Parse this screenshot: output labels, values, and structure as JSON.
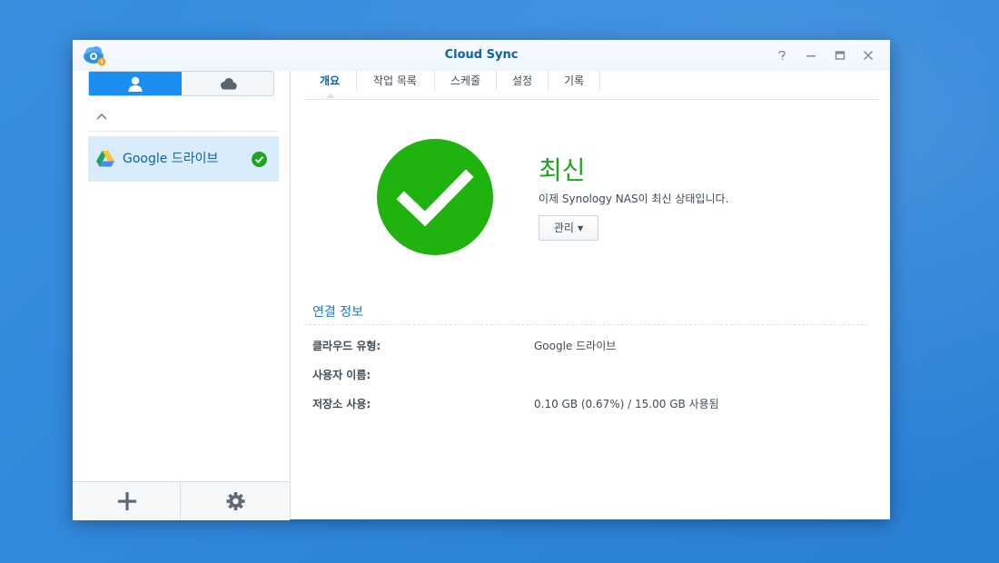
{
  "window": {
    "title": "Cloud Sync",
    "controls": [
      "help-icon",
      "minimize-icon",
      "maximize-icon",
      "close-icon"
    ]
  },
  "sidebar": {
    "segments": [
      {
        "icon": "user-icon",
        "active": true
      },
      {
        "icon": "cloud-icon",
        "active": false
      }
    ],
    "connections": [
      {
        "label": "Google 드라이브",
        "icon": "google-drive-icon",
        "status_icon": "check-circle-icon"
      }
    ],
    "footer": {
      "add_icon": "plus-icon",
      "settings_icon": "gear-icon"
    }
  },
  "tabs": [
    {
      "label": "개요",
      "active": true
    },
    {
      "label": "작업 목록",
      "active": false
    },
    {
      "label": "스케줄",
      "active": false
    },
    {
      "label": "설정",
      "active": false
    },
    {
      "label": "기록",
      "active": false
    }
  ],
  "status": {
    "title": "최신",
    "description": "이제 Synology NAS이 최신 상태입니다.",
    "manage_label": "관리",
    "color": "#20a521"
  },
  "connection_info": {
    "title": "연결 정보",
    "rows": [
      {
        "label": "클라우드 유형:",
        "value": "Google 드라이브"
      },
      {
        "label": "사용자 이름:",
        "value": ""
      },
      {
        "label": "저장소 사용:",
        "value": "0.10 GB (0.67%) / 15.00 GB 사용됨"
      }
    ]
  },
  "colors": {
    "accent": "#1b8ff1",
    "title_blue": "#0e62ad",
    "desktop": "#2f86dc"
  }
}
